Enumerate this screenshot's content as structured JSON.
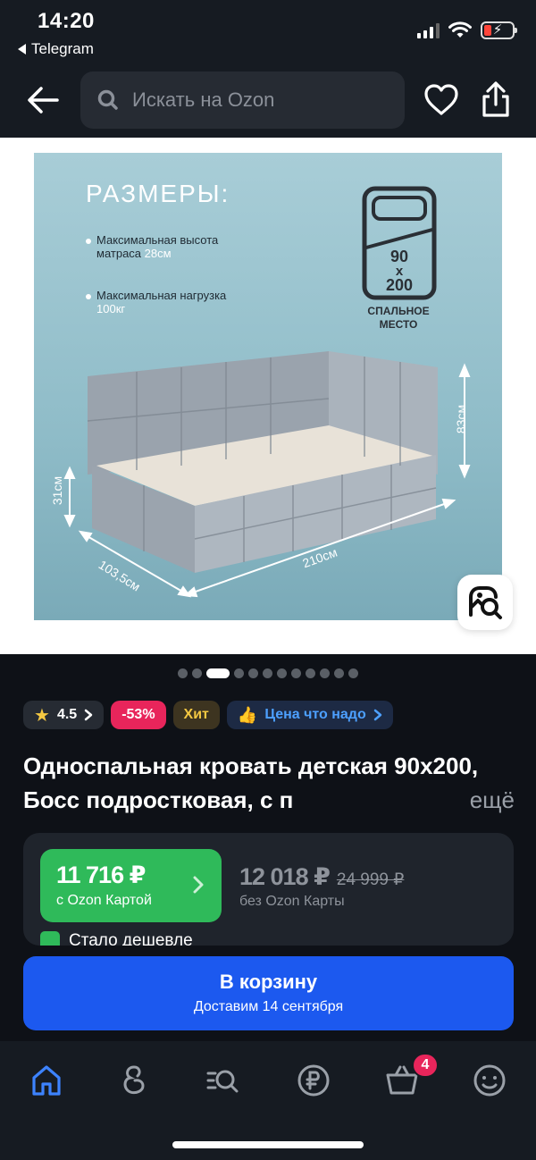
{
  "status_bar": {
    "time": "14:20",
    "back_app": "Telegram"
  },
  "header": {
    "search_placeholder": "Искать на Ozon"
  },
  "image": {
    "title": "РАЗМЕРЫ:",
    "bullet1_text": "Максимальная высота",
    "bullet1_line2": "матраса ",
    "bullet1_value": "28см",
    "bullet2_text": "Максимальная нагрузка",
    "bullet2_value": "100кг",
    "size_w": "90",
    "size_x": "x",
    "size_h": "200",
    "sleep_label_1": "СПАЛЬНОЕ",
    "sleep_label_2": "МЕСТО",
    "dim_height": "83см",
    "dim_side": "31см",
    "dim_width": "103,5см",
    "dim_length": "210см",
    "slide_count": 12,
    "active_slide": 3
  },
  "badges": {
    "rating": "4.5",
    "discount": "-53%",
    "hit": "Хит",
    "price_tag": "Цена что надо"
  },
  "product": {
    "title": "Односпальная кровать детская 90х200, Босс подростковая, с п",
    "more": "ещё"
  },
  "price": {
    "ozon_card_price": "11 716 ₽",
    "ozon_card_label": "с Ozon Картой",
    "regular_price": "12 018 ₽",
    "old_price": "24 999 ₽",
    "regular_label": "без Ozon Карты",
    "cheaper_text": "Стало дешевле"
  },
  "cta": {
    "main": "В корзину",
    "sub": "Доставим 14 сентября"
  },
  "tabbar": {
    "cart_count": "4"
  },
  "colors": {
    "accent_blue": "#1c59ef",
    "ozon_green": "#2fba5a",
    "discount_pink": "#e8255b",
    "hit_yellow": "#f4c842"
  }
}
